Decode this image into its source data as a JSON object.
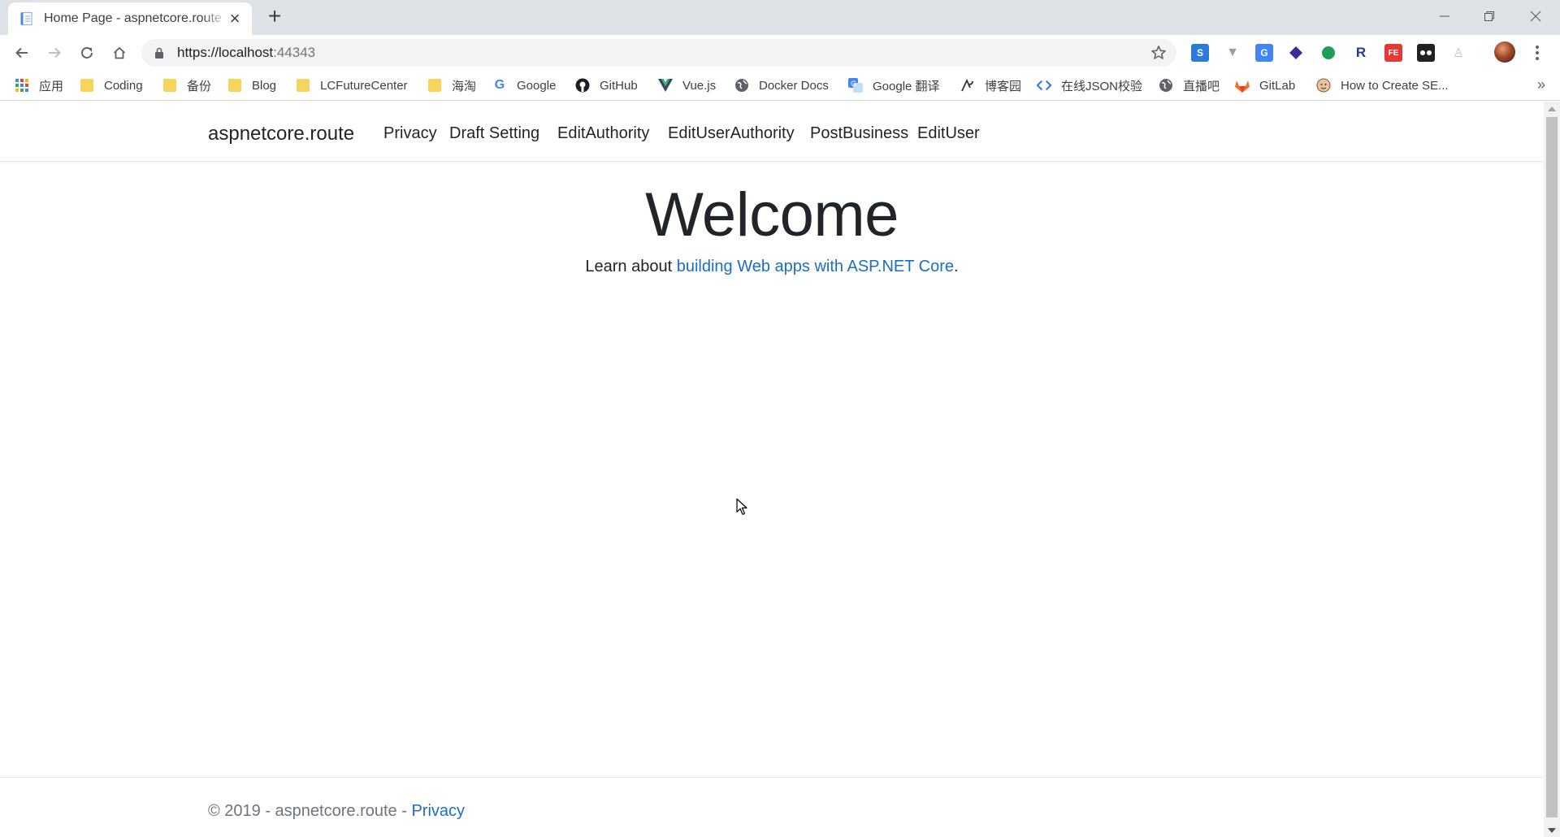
{
  "browser": {
    "tab": {
      "title": "Home Page - aspnetcore.route"
    },
    "address_bar": {
      "url_main": "https://localhost",
      "url_port": ":44343"
    }
  },
  "bookmarks": [
    {
      "label": "应用",
      "icon": "apps-grid-icon"
    },
    {
      "label": "Coding",
      "icon": "folder-icon"
    },
    {
      "label": "备份",
      "icon": "folder-icon"
    },
    {
      "label": "Blog",
      "icon": "folder-icon"
    },
    {
      "label": "LCFutureCenter",
      "icon": "folder-icon"
    },
    {
      "label": "海淘",
      "icon": "folder-icon"
    },
    {
      "label": "Google",
      "icon": "google-icon"
    },
    {
      "label": "GitHub",
      "icon": "github-icon"
    },
    {
      "label": "Vue.js",
      "icon": "vue-icon"
    },
    {
      "label": "Docker Docs",
      "icon": "globe-icon"
    },
    {
      "label": "Google 翻译",
      "icon": "translate-icon"
    },
    {
      "label": "博客园",
      "icon": "cnblogs-icon"
    },
    {
      "label": "在线JSON校验",
      "icon": "code-icon"
    },
    {
      "label": "直播吧",
      "icon": "globe-icon"
    },
    {
      "label": "GitLab",
      "icon": "gitlab-icon"
    },
    {
      "label": "How to Create SE...",
      "icon": "face-icon"
    }
  ],
  "site": {
    "brand": "aspnetcore.route",
    "nav": [
      "Privacy",
      "Draft Setting",
      "EditAuthority",
      "EditUserAuthority",
      "PostBusiness",
      "EditUser"
    ],
    "heading": "Welcome",
    "learn_prefix": "Learn about ",
    "learn_link": "building Web apps with ASP.NET Core",
    "learn_suffix": ".",
    "footer_text": "© 2019 - aspnetcore.route - ",
    "footer_link": "Privacy"
  },
  "colors": {
    "link": "#1b6ec2",
    "text": "#212529",
    "tabstrip": "#dee1e6"
  }
}
